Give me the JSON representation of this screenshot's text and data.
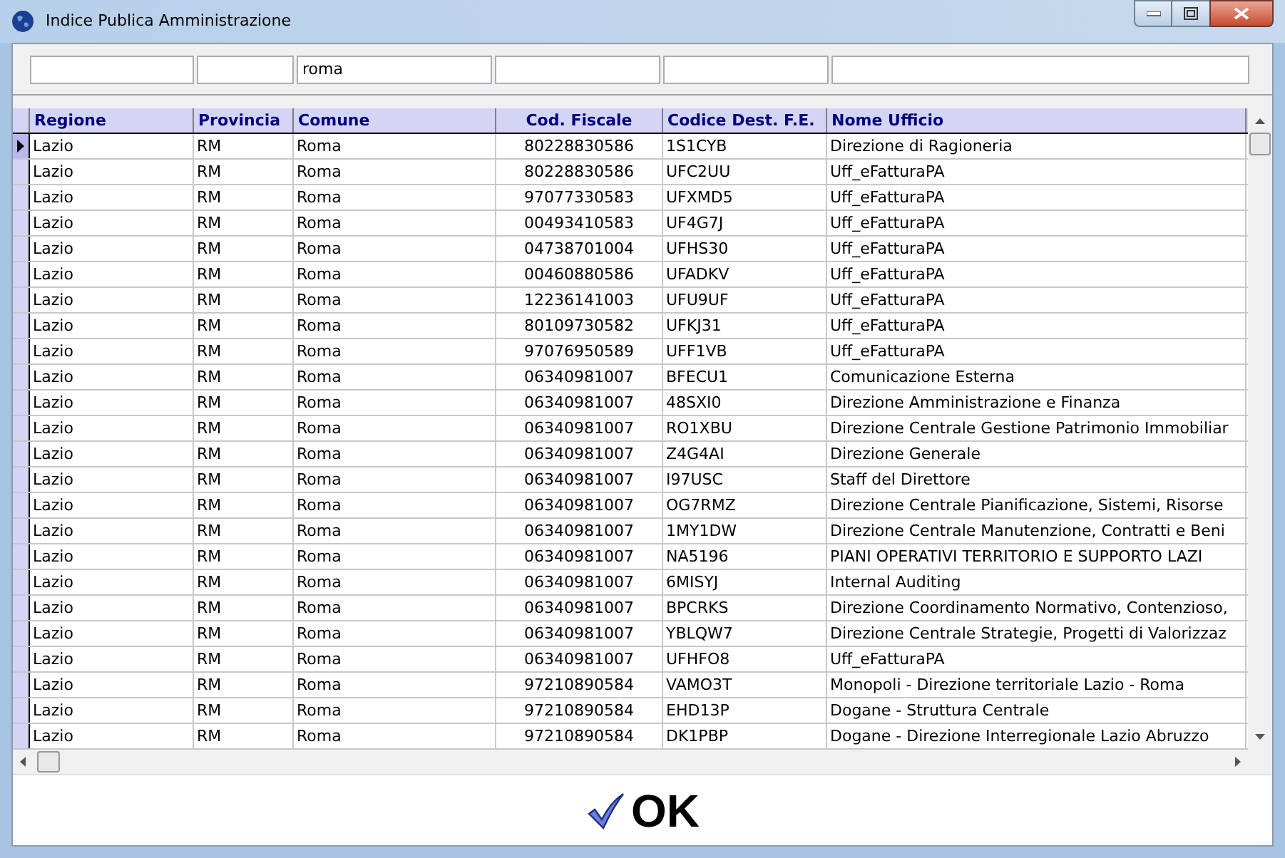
{
  "window": {
    "title": "Indice Publica Amministrazione"
  },
  "filters": {
    "comune": "roma"
  },
  "table": {
    "columns": [
      {
        "label": "Regione"
      },
      {
        "label": "Provincia"
      },
      {
        "label": "Comune"
      },
      {
        "label": "Cod. Fiscale"
      },
      {
        "label": "Codice Dest. F.E."
      },
      {
        "label": "Nome Ufficio"
      }
    ],
    "rows": [
      {
        "selected": true,
        "cells": [
          "Lazio",
          "RM",
          "Roma",
          "80228830586",
          "1S1CYB",
          "Direzione di Ragioneria"
        ]
      },
      {
        "selected": false,
        "cells": [
          "Lazio",
          "RM",
          "Roma",
          "80228830586",
          "UFC2UU",
          "Uff_eFatturaPA"
        ]
      },
      {
        "selected": false,
        "cells": [
          "Lazio",
          "RM",
          "Roma",
          "97077330583",
          "UFXMD5",
          "Uff_eFatturaPA"
        ]
      },
      {
        "selected": false,
        "cells": [
          "Lazio",
          "RM",
          "Roma",
          "00493410583",
          "UF4G7J",
          "Uff_eFatturaPA"
        ]
      },
      {
        "selected": false,
        "cells": [
          "Lazio",
          "RM",
          "Roma",
          "04738701004",
          "UFHS30",
          "Uff_eFatturaPA"
        ]
      },
      {
        "selected": false,
        "cells": [
          "Lazio",
          "RM",
          "Roma",
          "00460880586",
          "UFADKV",
          "Uff_eFatturaPA"
        ]
      },
      {
        "selected": false,
        "cells": [
          "Lazio",
          "RM",
          "Roma",
          "12236141003",
          "UFU9UF",
          "Uff_eFatturaPA"
        ]
      },
      {
        "selected": false,
        "cells": [
          "Lazio",
          "RM",
          "Roma",
          "80109730582",
          "UFKJ31",
          "Uff_eFatturaPA"
        ]
      },
      {
        "selected": false,
        "cells": [
          "Lazio",
          "RM",
          "Roma",
          "97076950589",
          "UFF1VB",
          "Uff_eFatturaPA"
        ]
      },
      {
        "selected": false,
        "cells": [
          "Lazio",
          "RM",
          "Roma",
          "06340981007",
          "BFECU1",
          "Comunicazione Esterna"
        ]
      },
      {
        "selected": false,
        "cells": [
          "Lazio",
          "RM",
          "Roma",
          "06340981007",
          "48SXI0",
          "Direzione Amministrazione e Finanza"
        ]
      },
      {
        "selected": false,
        "cells": [
          "Lazio",
          "RM",
          "Roma",
          "06340981007",
          "RO1XBU",
          "Direzione Centrale Gestione Patrimonio Immobiliar"
        ]
      },
      {
        "selected": false,
        "cells": [
          "Lazio",
          "RM",
          "Roma",
          "06340981007",
          "Z4G4AI",
          "Direzione Generale"
        ]
      },
      {
        "selected": false,
        "cells": [
          "Lazio",
          "RM",
          "Roma",
          "06340981007",
          "I97USC",
          "Staff del Direttore"
        ]
      },
      {
        "selected": false,
        "cells": [
          "Lazio",
          "RM",
          "Roma",
          "06340981007",
          "OG7RMZ",
          "Direzione Centrale Pianificazione, Sistemi, Risorse"
        ]
      },
      {
        "selected": false,
        "cells": [
          "Lazio",
          "RM",
          "Roma",
          "06340981007",
          "1MY1DW",
          "Direzione Centrale Manutenzione, Contratti e Beni"
        ]
      },
      {
        "selected": false,
        "cells": [
          "Lazio",
          "RM",
          "Roma",
          "06340981007",
          "NA5196",
          "PIANI OPERATIVI TERRITORIO E SUPPORTO LAZI"
        ]
      },
      {
        "selected": false,
        "cells": [
          "Lazio",
          "RM",
          "Roma",
          "06340981007",
          "6MISYJ",
          "Internal Auditing"
        ]
      },
      {
        "selected": false,
        "cells": [
          "Lazio",
          "RM",
          "Roma",
          "06340981007",
          "BPCRKS",
          "Direzione Coordinamento Normativo, Contenzioso,"
        ]
      },
      {
        "selected": false,
        "cells": [
          "Lazio",
          "RM",
          "Roma",
          "06340981007",
          "YBLQW7",
          "Direzione Centrale Strategie, Progetti di Valorizzaz"
        ]
      },
      {
        "selected": false,
        "cells": [
          "Lazio",
          "RM",
          "Roma",
          "06340981007",
          "UFHFO8",
          "Uff_eFatturaPA"
        ]
      },
      {
        "selected": false,
        "cells": [
          "Lazio",
          "RM",
          "Roma",
          "97210890584",
          "VAMO3T",
          "Monopoli - Direzione territoriale Lazio - Roma"
        ]
      },
      {
        "selected": false,
        "cells": [
          "Lazio",
          "RM",
          "Roma",
          "97210890584",
          "EHD13P",
          "Dogane - Struttura Centrale"
        ]
      },
      {
        "selected": false,
        "cells": [
          "Lazio",
          "RM",
          "Roma",
          "97210890584",
          "DK1PBP",
          "Dogane - Direzione Interregionale Lazio Abruzzo"
        ]
      }
    ]
  },
  "ok_button": {
    "label": "OK"
  }
}
